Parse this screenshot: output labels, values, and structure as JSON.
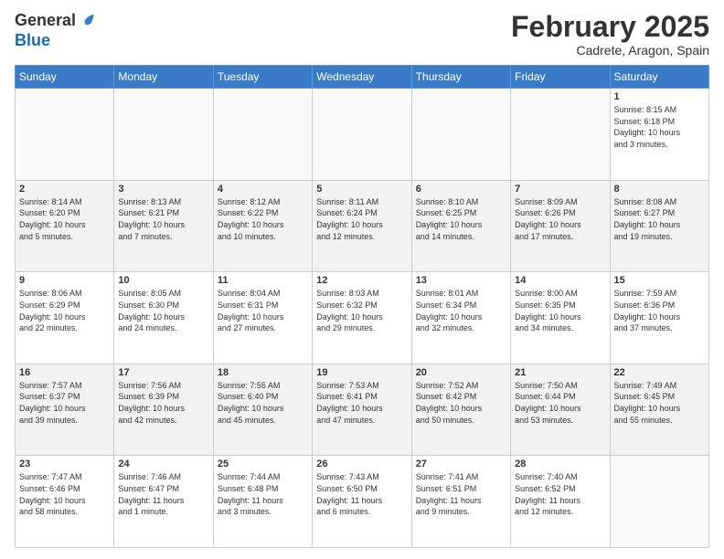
{
  "logo": {
    "general": "General",
    "blue": "Blue"
  },
  "title": "February 2025",
  "subtitle": "Cadrete, Aragon, Spain",
  "days_of_week": [
    "Sunday",
    "Monday",
    "Tuesday",
    "Wednesday",
    "Thursday",
    "Friday",
    "Saturday"
  ],
  "weeks": [
    [
      {
        "day": "",
        "info": ""
      },
      {
        "day": "",
        "info": ""
      },
      {
        "day": "",
        "info": ""
      },
      {
        "day": "",
        "info": ""
      },
      {
        "day": "",
        "info": ""
      },
      {
        "day": "",
        "info": ""
      },
      {
        "day": "1",
        "info": "Sunrise: 8:15 AM\nSunset: 6:18 PM\nDaylight: 10 hours\nand 3 minutes."
      }
    ],
    [
      {
        "day": "2",
        "info": "Sunrise: 8:14 AM\nSunset: 6:20 PM\nDaylight: 10 hours\nand 5 minutes."
      },
      {
        "day": "3",
        "info": "Sunrise: 8:13 AM\nSunset: 6:21 PM\nDaylight: 10 hours\nand 7 minutes."
      },
      {
        "day": "4",
        "info": "Sunrise: 8:12 AM\nSunset: 6:22 PM\nDaylight: 10 hours\nand 10 minutes."
      },
      {
        "day": "5",
        "info": "Sunrise: 8:11 AM\nSunset: 6:24 PM\nDaylight: 10 hours\nand 12 minutes."
      },
      {
        "day": "6",
        "info": "Sunrise: 8:10 AM\nSunset: 6:25 PM\nDaylight: 10 hours\nand 14 minutes."
      },
      {
        "day": "7",
        "info": "Sunrise: 8:09 AM\nSunset: 6:26 PM\nDaylight: 10 hours\nand 17 minutes."
      },
      {
        "day": "8",
        "info": "Sunrise: 8:08 AM\nSunset: 6:27 PM\nDaylight: 10 hours\nand 19 minutes."
      }
    ],
    [
      {
        "day": "9",
        "info": "Sunrise: 8:06 AM\nSunset: 6:29 PM\nDaylight: 10 hours\nand 22 minutes."
      },
      {
        "day": "10",
        "info": "Sunrise: 8:05 AM\nSunset: 6:30 PM\nDaylight: 10 hours\nand 24 minutes."
      },
      {
        "day": "11",
        "info": "Sunrise: 8:04 AM\nSunset: 6:31 PM\nDaylight: 10 hours\nand 27 minutes."
      },
      {
        "day": "12",
        "info": "Sunrise: 8:03 AM\nSunset: 6:32 PM\nDaylight: 10 hours\nand 29 minutes."
      },
      {
        "day": "13",
        "info": "Sunrise: 8:01 AM\nSunset: 6:34 PM\nDaylight: 10 hours\nand 32 minutes."
      },
      {
        "day": "14",
        "info": "Sunrise: 8:00 AM\nSunset: 6:35 PM\nDaylight: 10 hours\nand 34 minutes."
      },
      {
        "day": "15",
        "info": "Sunrise: 7:59 AM\nSunset: 6:36 PM\nDaylight: 10 hours\nand 37 minutes."
      }
    ],
    [
      {
        "day": "16",
        "info": "Sunrise: 7:57 AM\nSunset: 6:37 PM\nDaylight: 10 hours\nand 39 minutes."
      },
      {
        "day": "17",
        "info": "Sunrise: 7:56 AM\nSunset: 6:39 PM\nDaylight: 10 hours\nand 42 minutes."
      },
      {
        "day": "18",
        "info": "Sunrise: 7:55 AM\nSunset: 6:40 PM\nDaylight: 10 hours\nand 45 minutes."
      },
      {
        "day": "19",
        "info": "Sunrise: 7:53 AM\nSunset: 6:41 PM\nDaylight: 10 hours\nand 47 minutes."
      },
      {
        "day": "20",
        "info": "Sunrise: 7:52 AM\nSunset: 6:42 PM\nDaylight: 10 hours\nand 50 minutes."
      },
      {
        "day": "21",
        "info": "Sunrise: 7:50 AM\nSunset: 6:44 PM\nDaylight: 10 hours\nand 53 minutes."
      },
      {
        "day": "22",
        "info": "Sunrise: 7:49 AM\nSunset: 6:45 PM\nDaylight: 10 hours\nand 55 minutes."
      }
    ],
    [
      {
        "day": "23",
        "info": "Sunrise: 7:47 AM\nSunset: 6:46 PM\nDaylight: 10 hours\nand 58 minutes."
      },
      {
        "day": "24",
        "info": "Sunrise: 7:46 AM\nSunset: 6:47 PM\nDaylight: 11 hours\nand 1 minute."
      },
      {
        "day": "25",
        "info": "Sunrise: 7:44 AM\nSunset: 6:48 PM\nDaylight: 11 hours\nand 3 minutes."
      },
      {
        "day": "26",
        "info": "Sunrise: 7:43 AM\nSunset: 6:50 PM\nDaylight: 11 hours\nand 6 minutes."
      },
      {
        "day": "27",
        "info": "Sunrise: 7:41 AM\nSunset: 6:51 PM\nDaylight: 11 hours\nand 9 minutes."
      },
      {
        "day": "28",
        "info": "Sunrise: 7:40 AM\nSunset: 6:52 PM\nDaylight: 11 hours\nand 12 minutes."
      },
      {
        "day": "",
        "info": ""
      }
    ]
  ]
}
